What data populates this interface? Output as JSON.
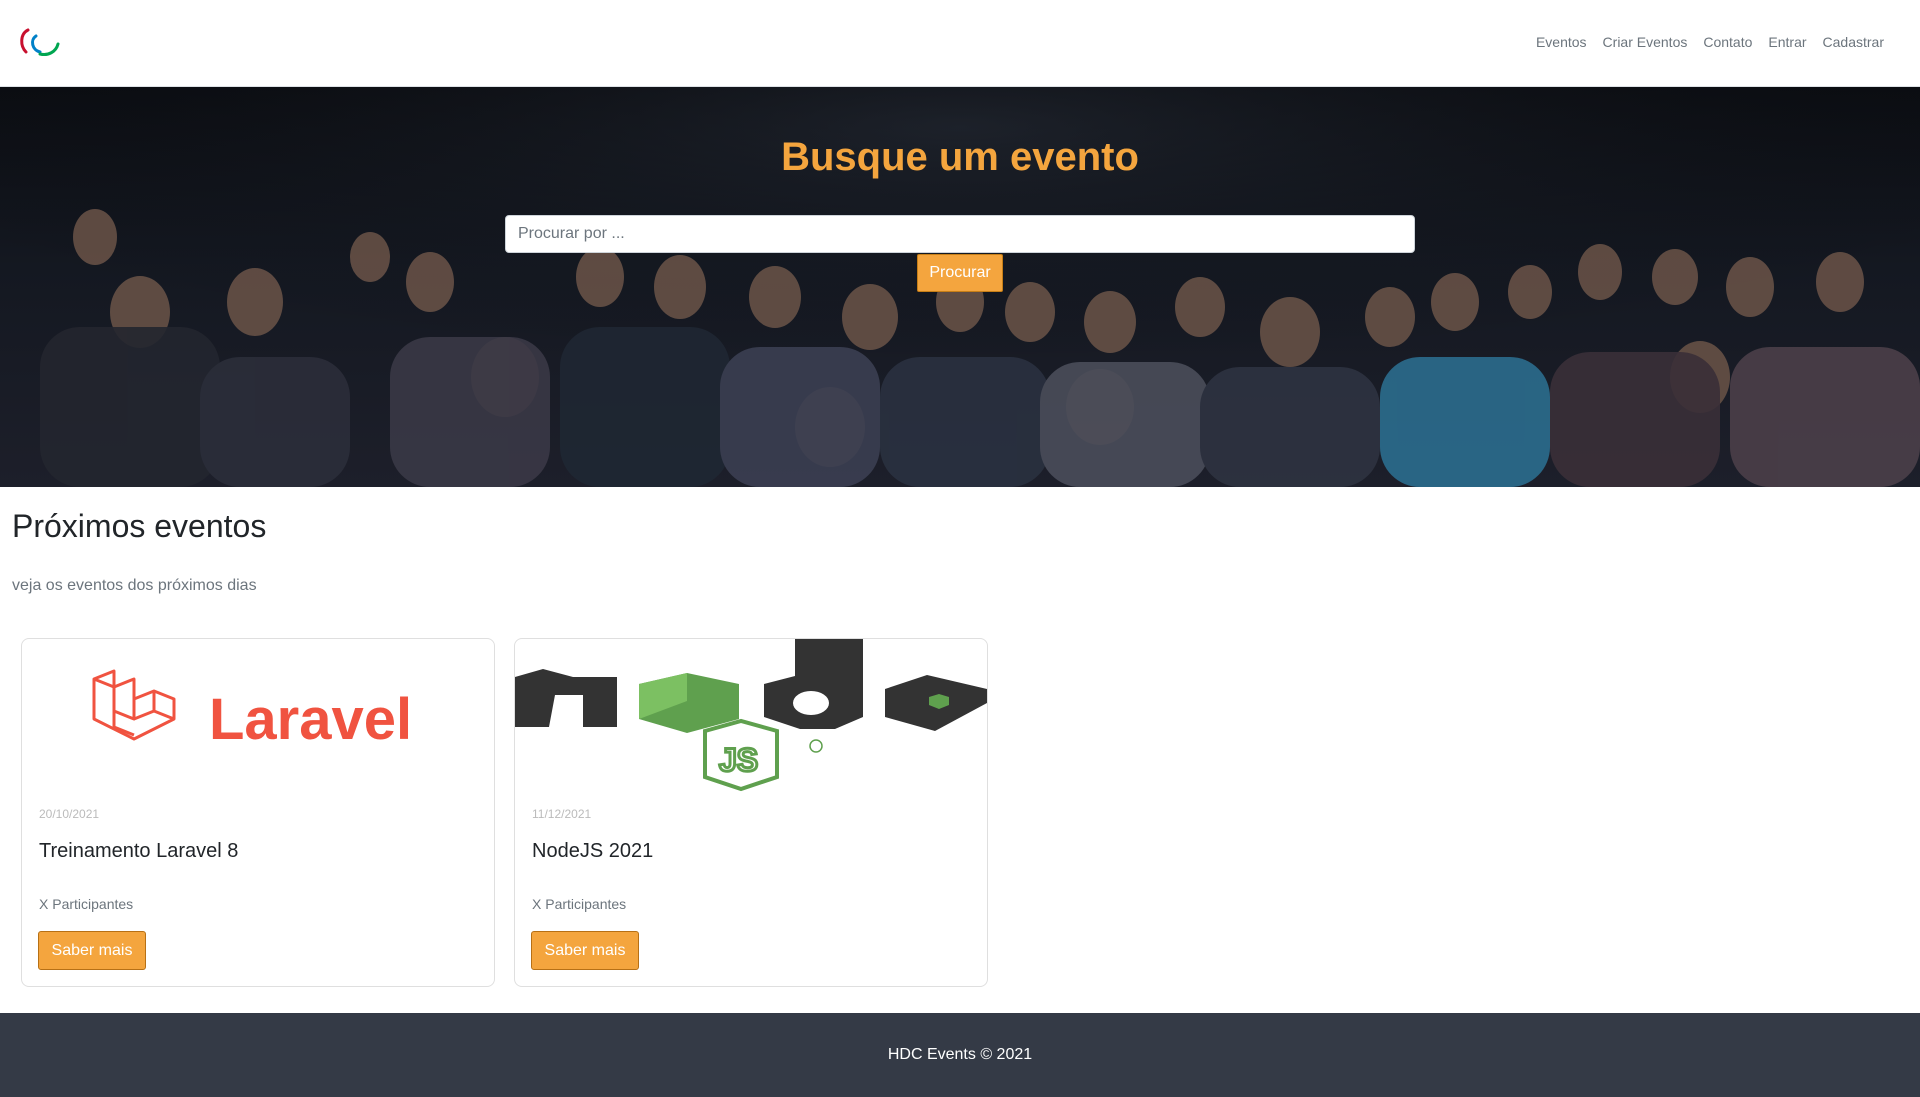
{
  "navbar": {
    "logo": "paralympic-agitos-logo",
    "links": [
      "Eventos",
      "Criar Eventos",
      "Contato",
      "Entrar",
      "Cadastrar"
    ]
  },
  "hero": {
    "title": "Busque um evento",
    "search_placeholder": "Procurar por ...",
    "search_button": "Procurar",
    "background": "audience-photo"
  },
  "events_section": {
    "title": "Próximos eventos",
    "subtitle": "veja os eventos dos próximos dias",
    "cards": [
      {
        "image": "laravel-logo",
        "image_text": "Laravel",
        "date": "20/10/2021",
        "title": "Treinamento Laravel 8",
        "participants": "X Participantes",
        "button": "Saber mais"
      },
      {
        "image": "nodejs-logo",
        "image_text": "JS",
        "date": "11/12/2021",
        "title": "NodeJS 2021",
        "participants": "X Participantes",
        "button": "Saber mais"
      }
    ]
  },
  "footer": {
    "text": "HDC Events © 2021"
  },
  "colors": {
    "accent": "#f4a53e",
    "footer_bg": "#343a46",
    "laravel_red": "#f05340",
    "node_dark": "#333333",
    "node_green": "#5fa04e"
  }
}
